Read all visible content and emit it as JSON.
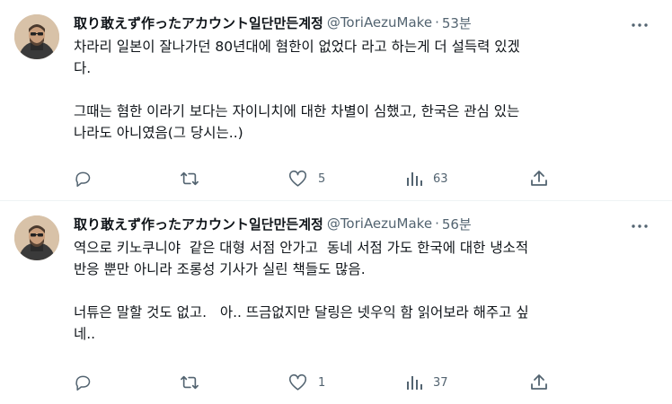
{
  "tweets": [
    {
      "name": "取り敢えず作ったアカウント일단만든계정",
      "handle": "@ToriAezuMake",
      "separator": "·",
      "time": "53분",
      "text": "차라리 일본이 잘나가던 80년대에 혐한이 없었다 라고 하는게 더 설득력 있겠\n다.\n\n그때는 혐한 이라기 보다는 자이니치에 대한 차별이 심했고, 한국은 관심 있는\n나라도 아니였음(그 당시는..)",
      "actions": {
        "replies": "",
        "retweets": "",
        "likes": "5",
        "views": "63"
      }
    },
    {
      "name": "取り敢えず作ったアカウント일단만든계정",
      "handle": "@ToriAezuMake",
      "separator": "·",
      "time": "56분",
      "text": "역으로 키노쿠니야  같은 대형 서점 안가고  동네 서점 가도 한국에 대한 냉소적\n반응 뿐만 아니라 조롱성 기사가 실린 책들도 많음.\n\n너튜은 말할 것도 없고.   아.. 뜨금없지만 달링은 넷우익 함 읽어보라 해주고 싶\n네..",
      "actions": {
        "replies": "",
        "retweets": "",
        "likes": "1",
        "views": "37"
      }
    }
  ],
  "icons": {
    "more": "more-dots-icon",
    "reply": "reply-icon",
    "retweet": "retweet-icon",
    "like": "heart-icon",
    "views": "views-bar-chart-icon",
    "share": "share-icon"
  },
  "colors": {
    "text": "#0f1419",
    "secondary": "#536471",
    "divider": "#eff3f4"
  }
}
